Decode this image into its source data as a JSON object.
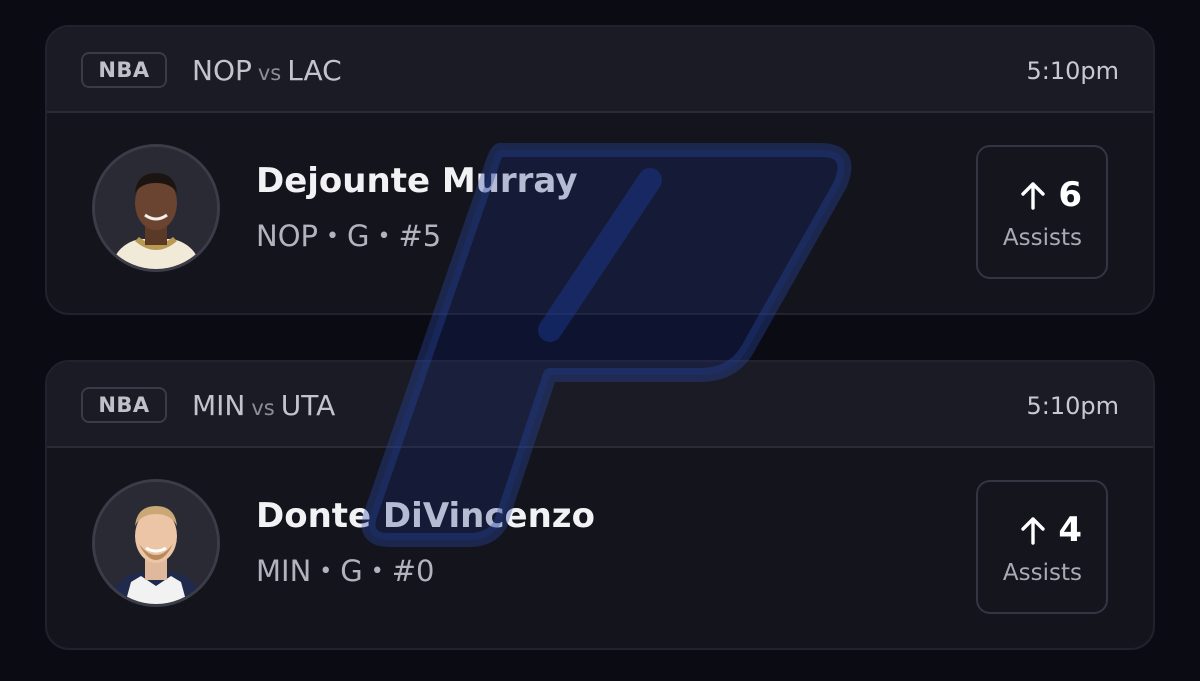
{
  "picks": [
    {
      "league": "NBA",
      "home_team": "NOP",
      "vs_label": "vs",
      "away_team": "LAC",
      "time": "5:10pm",
      "player": {
        "name": "Dejounte Murray",
        "team": "NOP",
        "position": "G",
        "number": "#5"
      },
      "stat": {
        "direction": "up-arrow-icon",
        "value": "6",
        "label": "Assists"
      }
    },
    {
      "league": "NBA",
      "home_team": "MIN",
      "vs_label": "vs",
      "away_team": "UTA",
      "time": "5:10pm",
      "player": {
        "name": "Donte DiVincenzo",
        "team": "MIN",
        "position": "G",
        "number": "#0"
      },
      "stat": {
        "direction": "up-arrow-icon",
        "value": "4",
        "label": "Assists"
      }
    }
  ],
  "meta_separator": "•",
  "colors": {
    "background": "#0b0b13",
    "card": "#14141d",
    "header": "#1b1b25",
    "watermark": "#1a2f7a"
  }
}
